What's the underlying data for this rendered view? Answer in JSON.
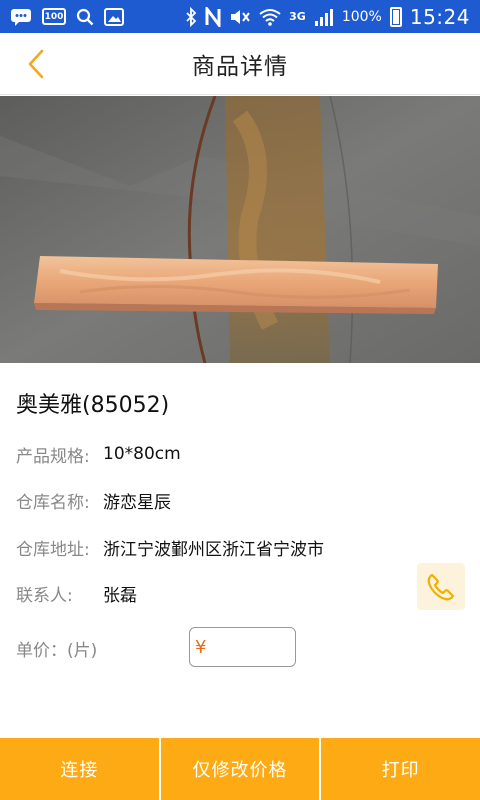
{
  "status_bar": {
    "box_icon_text": "100",
    "network_label": "3G",
    "battery_text": "100%",
    "time": "15:24"
  },
  "header": {
    "title": "商品详情",
    "back_icon": "chevron-left-icon"
  },
  "gallery": {
    "image_count": 3,
    "active_index": 0
  },
  "product": {
    "name": "奥美雅(85052)",
    "fields": [
      {
        "label": "产品规格:",
        "value": "10*80cm"
      },
      {
        "label": "仓库名称:",
        "value": "游恋星辰"
      },
      {
        "label": "仓库地址:",
        "value": "浙江宁波鄞州区浙江省宁波市"
      },
      {
        "label": "联系人:",
        "value": "张磊"
      }
    ],
    "price_label": "单价：(片)",
    "currency_symbol": "¥",
    "price_value": ""
  },
  "actions": {
    "connect": "连接",
    "modify_price": "仅修改价格",
    "print": "打印"
  },
  "colors": {
    "status_bar": "#1f5bd0",
    "accent": "#fdaa15",
    "back_arrow": "#f5a623",
    "phone_bg": "#fdf3dc",
    "yen": "#e66e1a"
  }
}
